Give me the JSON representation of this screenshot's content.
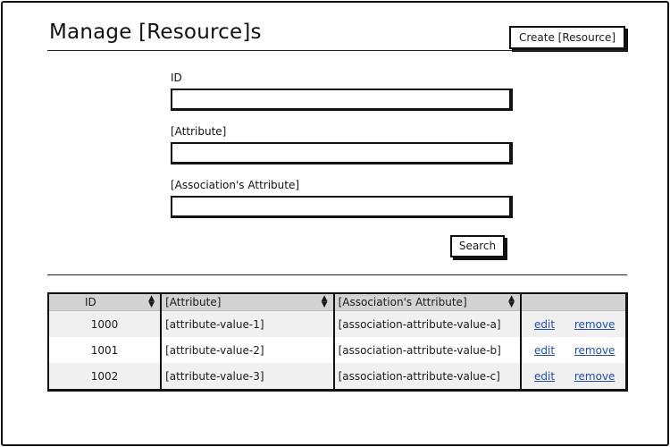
{
  "header": {
    "title": "Manage [Resource]s",
    "create_button": "Create [Resource]"
  },
  "search_form": {
    "fields": [
      {
        "label": "ID",
        "value": ""
      },
      {
        "label": "[Attribute]",
        "value": ""
      },
      {
        "label": "[Association's Attribute]",
        "value": ""
      }
    ],
    "search_button": "Search"
  },
  "results_table": {
    "columns": [
      "ID",
      "[Attribute]",
      "[Association's Attribute]",
      ""
    ],
    "rows": [
      {
        "id": "1000",
        "attribute": "[attribute-value-1]",
        "association_attribute": "[association-attribute-value-a]",
        "edit": "edit",
        "remove": "remove"
      },
      {
        "id": "1001",
        "attribute": "[attribute-value-2]",
        "association_attribute": "[association-attribute-value-b]",
        "edit": "edit",
        "remove": "remove"
      },
      {
        "id": "1002",
        "attribute": "[attribute-value-3]",
        "association_attribute": "[association-attribute-value-c]",
        "edit": "edit",
        "remove": "remove"
      }
    ]
  },
  "colors": {
    "header_bg": "#d3d3d3",
    "link": "#1f4fb0",
    "stripe": "#f0f0f0"
  },
  "icons": {
    "sort": "sort-arrows-icon"
  }
}
